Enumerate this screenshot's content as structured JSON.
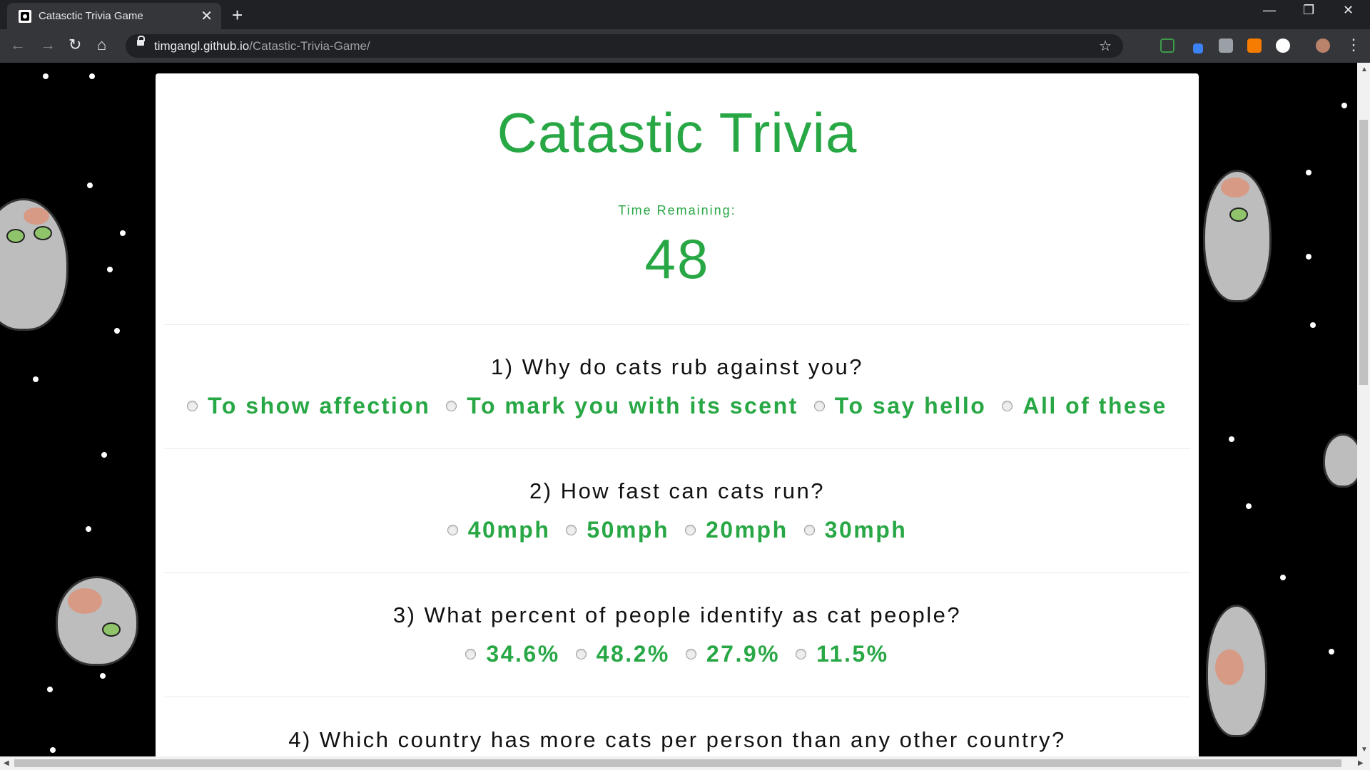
{
  "browser": {
    "tab_title": "Catasctic Trivia Game",
    "tab_close": "✕",
    "new_tab": "+",
    "url_domain": "timgangl.github.io",
    "url_path": "/Catastic-Trivia-Game/",
    "back": "←",
    "forward": "→",
    "reload": "↻",
    "home": "⌂",
    "bookmark": "☆",
    "minimize": "—",
    "maximize": "❐",
    "close": "✕",
    "menu": "⋮"
  },
  "page": {
    "title": "Catastic Trivia",
    "time_label": "Time Remaining:",
    "time_value": "48",
    "questions": [
      {
        "text": "1) Why do cats rub against you?",
        "choices": [
          "To show affection",
          "To mark you with its scent",
          "To say hello",
          "All of these"
        ]
      },
      {
        "text": "2) How fast can cats run?",
        "choices": [
          "40mph",
          "50mph",
          "20mph",
          "30mph"
        ]
      },
      {
        "text": "3) What percent of people identify as cat people?",
        "choices": [
          "34.6%",
          "48.2%",
          "27.9%",
          "11.5%"
        ]
      },
      {
        "text": "4) Which country has more cats per person than any other country?",
        "choices": []
      }
    ]
  },
  "colors": {
    "accent_green": "#28a745",
    "background": "#000000",
    "panel": "#ffffff"
  }
}
